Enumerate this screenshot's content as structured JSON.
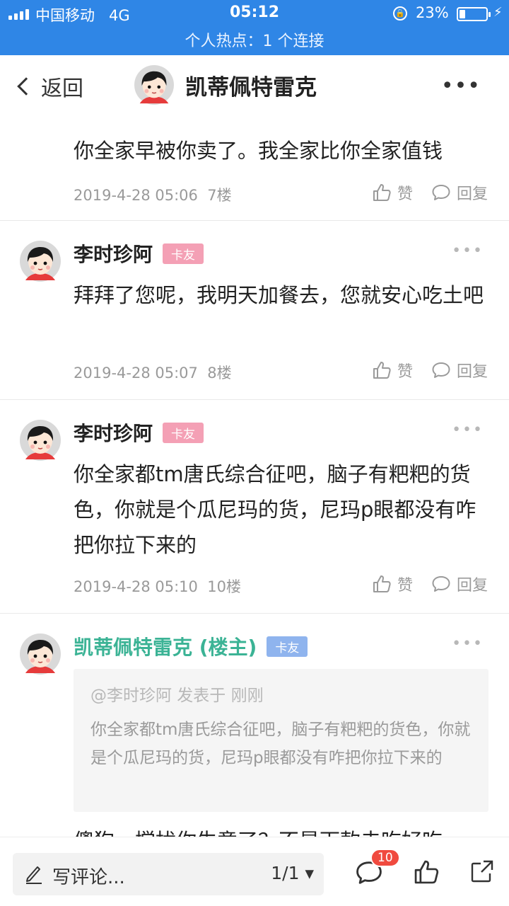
{
  "status_bar": {
    "carrier": "中国移动",
    "network": "4G",
    "time": "05:12",
    "battery": "23%",
    "battery_level": 0.23,
    "hotspot": "个人热点：1 个连接"
  },
  "nav": {
    "back_label": "返回",
    "title": "凯蒂佩特雷克",
    "more": "•••"
  },
  "actions": {
    "like": "赞",
    "reply": "回复"
  },
  "posts": [
    {
      "text": "你全家早被你卖了。我全家比你全家值钱",
      "timestamp": "2019-4-28 05:06",
      "floor": "7楼"
    },
    {
      "author": "李时珍阿",
      "badge": "卡友",
      "text": "拜拜了您呢，我明天加餐去，您就安心吃土吧",
      "timestamp": "2019-4-28 05:07",
      "floor": "8楼",
      "more": "•••"
    },
    {
      "author": "李时珍阿",
      "badge": "卡友",
      "text": "你全家都tm唐氏综合征吧，脑子有粑粑的货色，你就是个瓜尼玛的货，尼玛p眼都没有咋把你拉下来的",
      "timestamp": "2019-4-28 05:10",
      "floor": "10楼",
      "more": "•••"
    },
    {
      "author": "凯蒂佩特雷克 (楼主)",
      "badge": "卡友",
      "more": "•••",
      "quote_header": "@李时珍阿 发表于 刚刚",
      "quote_text": "你全家都tm唐氏综合征吧，脑子有粑粑的货色，你就是个瓜尼玛的货，尼玛p眼都没有咋把你拉下来的",
      "text": "傻狗，搅扰你生意了？不是下款去吃好吃"
    }
  ],
  "bottom_bar": {
    "comment_placeholder": "写评论...",
    "page_indicator": "1/1 ▾",
    "comment_count": "10"
  },
  "icons": [
    "back-chevron-icon",
    "more-icon",
    "thumb-up-icon",
    "comment-bubble-icon",
    "pencil-icon",
    "share-icon"
  ],
  "colors": {
    "status_bar": "#2f86e6",
    "host_name": "#3bb395",
    "badge_pink": "#f4a0b5",
    "badge_blue": "#8fb4ee",
    "notif_red": "#f04a3f"
  }
}
